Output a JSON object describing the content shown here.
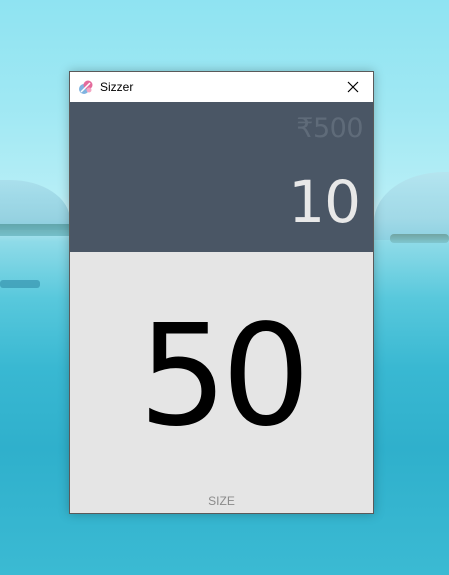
{
  "window": {
    "title": "Sizzer",
    "app_icon": "sizzer-app-icon",
    "close_icon": "close-icon"
  },
  "display": {
    "price": "₹500",
    "quantity": "10"
  },
  "size": {
    "value": "50",
    "label": "SIZE"
  },
  "colors": {
    "display_background": "#4a5665",
    "body_background": "#e5e5e5",
    "price_text": "#5f6b79",
    "quantity_text": "#e8e8e8"
  }
}
